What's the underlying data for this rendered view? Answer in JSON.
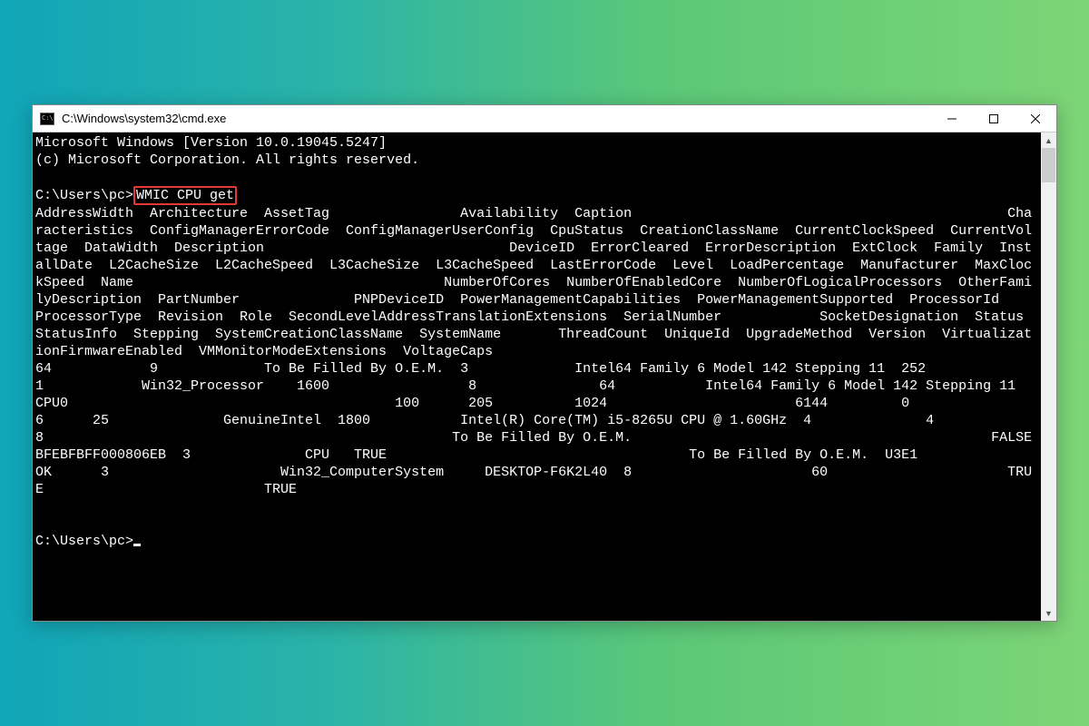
{
  "window": {
    "title": "C:\\Windows\\system32\\cmd.exe"
  },
  "terminal": {
    "header_line1": "Microsoft Windows [Version 10.0.19045.5247]",
    "header_line2": "(c) Microsoft Corporation. All rights reserved.",
    "prompt1_prefix": "C:\\Users\\pc>",
    "command": "WMIC CPU get",
    "columns_block": "AddressWidth  Architecture  AssetTag                Availability  Caption                                              Characteristics  ConfigManagerErrorCode  ConfigManagerUserConfig  CpuStatus  CreationClassName  CurrentClockSpeed  CurrentVoltage  DataWidth  Description                              DeviceID  ErrorCleared  ErrorDescription  ExtClock  Family  InstallDate  L2CacheSize  L2CacheSpeed  L3CacheSize  L3CacheSpeed  LastErrorCode  Level  LoadPercentage  Manufacturer  MaxClockSpeed  Name                                      NumberOfCores  NumberOfEnabledCore  NumberOfLogicalProcessors  OtherFamilyDescription  PartNumber              PNPDeviceID  PowerManagementCapabilities  PowerManagementSupported  ProcessorId       ProcessorType  Revision  Role  SecondLevelAddressTranslationExtensions  SerialNumber            SocketDesignation  Status  StatusInfo  Stepping  SystemCreationClassName  SystemName       ThreadCount  UniqueId  UpgradeMethod  Version  VirtualizationFirmwareEnabled  VMMonitorModeExtensions  VoltageCaps",
    "values_block": "64            9             To Be Filled By O.E.M.  3             Intel64 Family 6 Model 142 Stepping 11  252                                                               1            Win32_Processor    1600                 8               64           Intel64 Family 6 Model 142 Stepping 11  CPU0                                        100      205          1024                       6144         0                            6      25              GenuineIntel  1800           Intel(R) Core(TM) i5-8265U CPU @ 1.60GHz  4              4                    8                                                  To Be Filled By O.E.M.                                            FALSE                     BFEBFBFF000806EB  3              CPU   TRUE                                     To Be Filled By O.E.M.  U3E1               OK      3                     Win32_ComputerSystem     DESKTOP-F6K2L40  8                      60                      TRUE                           TRUE                     ",
    "prompt2": "C:\\Users\\pc>"
  }
}
